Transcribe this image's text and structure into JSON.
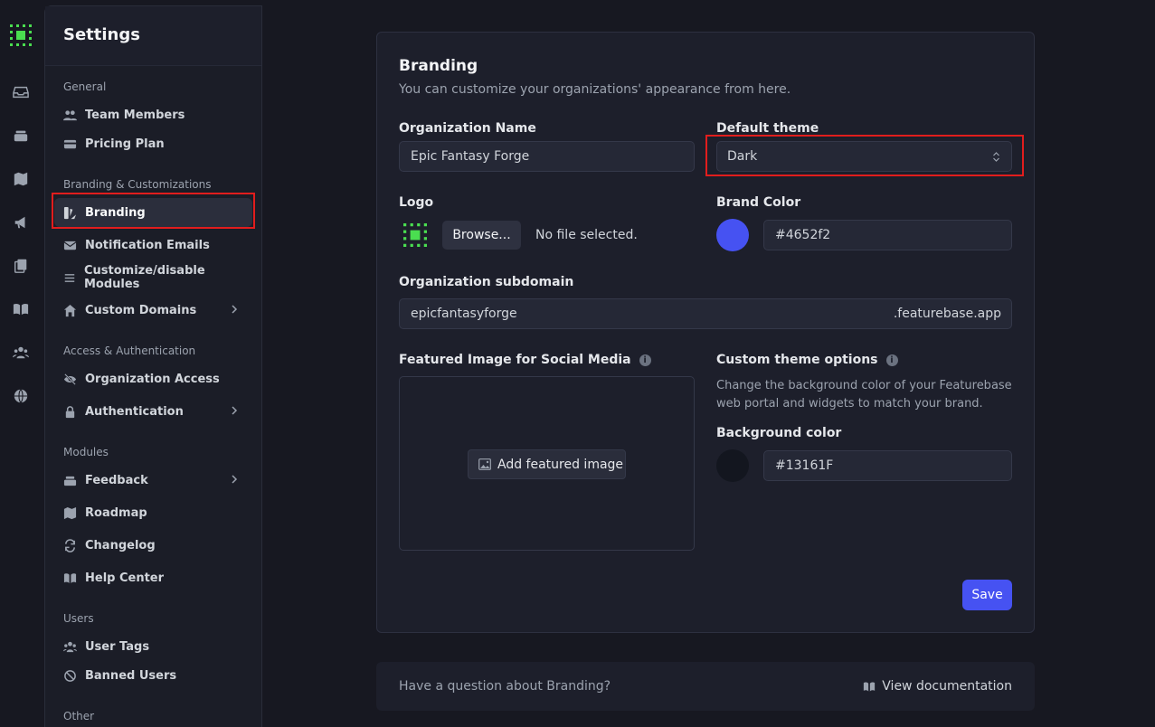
{
  "sidebar": {
    "title": "Settings",
    "sections": {
      "general": "General",
      "branding": "Branding & Customizations",
      "access": "Access & Authentication",
      "modules": "Modules",
      "users": "Users",
      "other": "Other"
    },
    "items": {
      "team_members": "Team Members",
      "pricing_plan": "Pricing Plan",
      "branding": "Branding",
      "notification_emails": "Notification Emails",
      "customize_modules": "Customize/disable Modules",
      "custom_domains": "Custom Domains",
      "organization_access": "Organization Access",
      "authentication": "Authentication",
      "feedback": "Feedback",
      "roadmap": "Roadmap",
      "changelog": "Changelog",
      "help_center": "Help Center",
      "user_tags": "User Tags",
      "banned_users": "Banned Users"
    }
  },
  "branding": {
    "title": "Branding",
    "subtitle": "You can customize your organizations' appearance from here.",
    "org_name_label": "Organization Name",
    "org_name_value": "Epic Fantasy Forge",
    "default_theme_label": "Default theme",
    "default_theme_value": "Dark",
    "logo_label": "Logo",
    "browse_label": "Browse...",
    "no_file": "No file selected.",
    "brand_color_label": "Brand Color",
    "brand_color_value": "#4652f2",
    "subdomain_label": "Organization subdomain",
    "subdomain_value": "epicfantasyforge",
    "subdomain_suffix": ".featurebase.app",
    "featured_image_label": "Featured Image for Social Media",
    "add_featured_image": "Add featured image",
    "custom_theme_label": "Custom theme options",
    "custom_theme_desc_1": "Change the background color of your Featurebase",
    "custom_theme_desc_2": "web portal and widgets to match your brand.",
    "bg_color_label": "Background color",
    "bg_color_value": "#13161F",
    "save_label": "Save"
  },
  "footer": {
    "question": "Have a question about Branding?",
    "doc_link": "View documentation"
  },
  "colors": {
    "brand": "#4652f2",
    "background": "#13161F",
    "highlight": "#e11d1d",
    "logo_green": "#4ade50"
  }
}
